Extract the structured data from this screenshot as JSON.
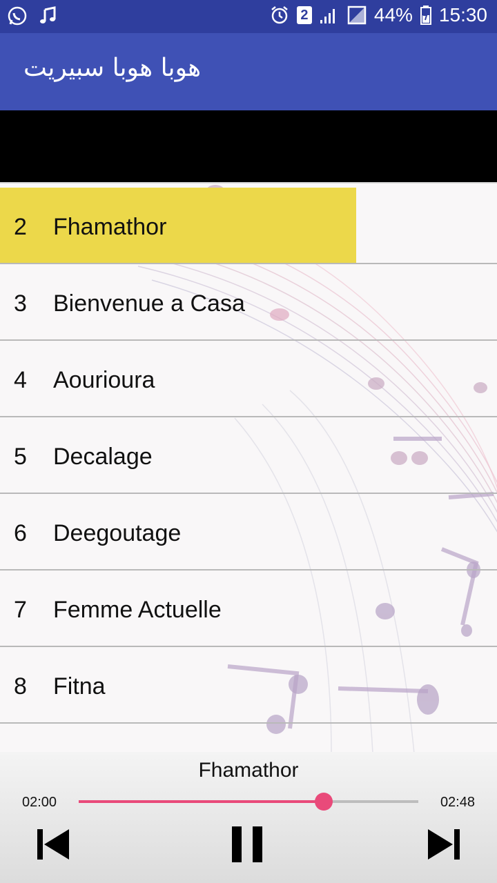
{
  "status_bar": {
    "notification_count": "2",
    "battery": "44%",
    "time": "15:30",
    "icons": [
      "whatsapp-icon",
      "music-note-icon",
      "alarm-icon",
      "signal-icon",
      "no-sim-icon",
      "battery-icon"
    ]
  },
  "app_bar": {
    "title": "هوبا هوبا سبيريت"
  },
  "tracks": [
    {
      "num": "2",
      "title": "Fhamathor",
      "active": true
    },
    {
      "num": "3",
      "title": "Bienvenue a Casa"
    },
    {
      "num": "4",
      "title": "Aourioura"
    },
    {
      "num": "5",
      "title": "Decalage"
    },
    {
      "num": "6",
      "title": "Deegoutage"
    },
    {
      "num": "7",
      "title": "Femme Actuelle"
    },
    {
      "num": "8",
      "title": "Fitna"
    }
  ],
  "player": {
    "now_playing": "Fhamathor",
    "elapsed": "02:00",
    "total": "02:48",
    "progress": 0.721,
    "accent_color": "#e94a7a",
    "highlight_color": "#ecd84a",
    "primary_color": "#3f51b5"
  }
}
